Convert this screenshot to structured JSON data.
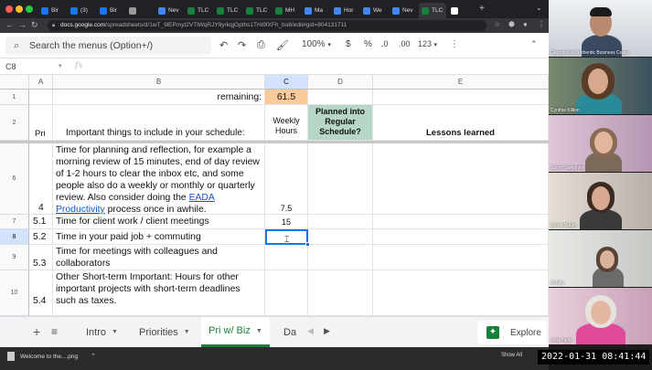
{
  "browser": {
    "tabs": [
      {
        "label": "Bir",
        "icon": "facebook-icon",
        "color": "#1877f2"
      },
      {
        "label": "(3)",
        "icon": "facebook-icon",
        "color": "#1877f2"
      },
      {
        "label": "Bir",
        "icon": "facebook-icon",
        "color": "#1877f2"
      },
      {
        "label": "",
        "icon": "link-icon",
        "color": "#999999"
      },
      {
        "label": "Nev",
        "icon": "google-icon",
        "color": "#4285f4"
      },
      {
        "label": "TLC",
        "icon": "sheets-icon",
        "color": "#188038"
      },
      {
        "label": "TLC",
        "icon": "sheets-icon",
        "color": "#188038"
      },
      {
        "label": "TLC",
        "icon": "sheets-icon",
        "color": "#188038"
      },
      {
        "label": "MH",
        "icon": "sheets-icon",
        "color": "#188038"
      },
      {
        "label": "Ma",
        "icon": "docs-icon",
        "color": "#4285f4"
      },
      {
        "label": "Hor",
        "icon": "google-icon",
        "color": "#4285f4"
      },
      {
        "label": "We",
        "icon": "google-icon",
        "color": "#4285f4"
      },
      {
        "label": "Nev",
        "icon": "google-icon",
        "color": "#4285f4"
      },
      {
        "label": "TLC",
        "icon": "sheets-icon",
        "color": "#188038"
      },
      {
        "label": "",
        "icon": "close-icon",
        "color": "#ffffff"
      }
    ],
    "url_host": "docs.google.com",
    "url_path": "/spreadsheets/d/1wT_9lEPmyt2VTlWqRJY9yrkqjGpths1THi9fXFh_bo8/edit#gid=804131711"
  },
  "toolbar": {
    "search_placeholder": "Search the menus (Option+/)",
    "zoom": "100%",
    "currency": "$",
    "percent": "%",
    "dec_decrease": ".0",
    "dec_increase": ".00",
    "more_formats": "123"
  },
  "formula_bar": {
    "cell_ref": "C8",
    "fx": "fx"
  },
  "grid": {
    "columns": [
      "A",
      "B",
      "C",
      "D",
      "E"
    ],
    "rows": [
      "1",
      "2",
      "6",
      "7",
      "8",
      "9",
      "10"
    ],
    "cells": {
      "b1": "remaining:",
      "c1": "61.5",
      "a2": "Pri",
      "b2": "Important things to include in your schedule:",
      "c2": "Weekly Hours",
      "d2": "Planned into Regular Schedule?",
      "e2": "Lessons learned",
      "a6": "4",
      "b6_text": "Time for planning and reflection, for example a morning review of 15 minutes, end of day review of 1-2 hours to clear the inbox etc, and some people also do a weekly or monthly or quarterly review. Also consider doing the",
      "b6_link": "EADA Productivity",
      "b6_tail": "process once in awhile.",
      "c6": "7.5",
      "a7": "5.1",
      "b7": "Time for client work / client meetings",
      "c7": "15",
      "a8": "5.2",
      "b8": "Time in your paid job + commuting",
      "a9": "5.3",
      "b9": "Time for meetings with colleagues and collaborators",
      "a10": "5.4",
      "b10": "Other Short-term Important: Hours for other important projects with short-term deadlines such as taxes."
    }
  },
  "sheets": {
    "add": "+",
    "tabs": [
      "Intro",
      "Priorities",
      "Pri w/ Biz",
      "Da"
    ],
    "explore": "Explore"
  },
  "downloads": {
    "file": "Welcome to the....png",
    "show_all": "Show All"
  },
  "video": {
    "participants": [
      {
        "name": "George Kao Authentic Business Coach"
      },
      {
        "name": "Cynthia Killion"
      },
      {
        "name": "Sunny Swearsky"
      },
      {
        "name": "Lynne Baum"
      },
      {
        "name": "Ashley"
      },
      {
        "name": "Jutta Held"
      }
    ],
    "timestamp": "2022-01-31  08:41:44"
  },
  "colors": {
    "remaining_fill": "#f9cb9c",
    "planned_fill": "#b6d7c8",
    "selection": "#1a73e8",
    "active_tab": "#188038"
  }
}
